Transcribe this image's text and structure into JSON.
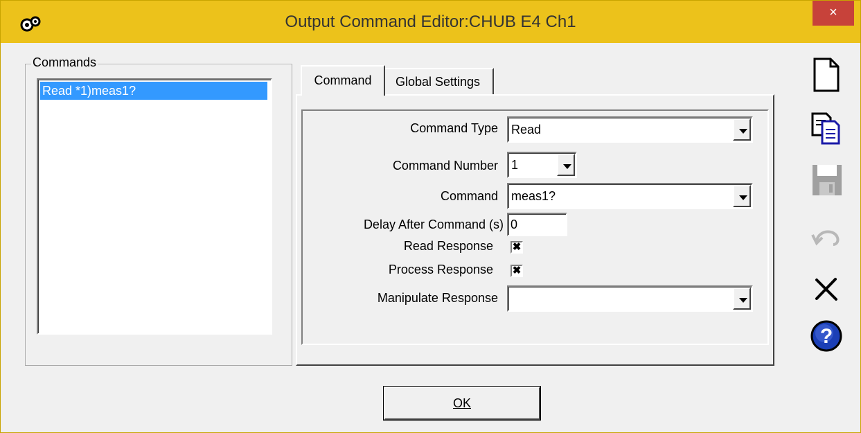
{
  "window": {
    "title": "Output Command Editor:CHUB E4 Ch1",
    "close_label": "×"
  },
  "commands_group": {
    "legend": "Commands",
    "items": [
      "Read *1)meas1?"
    ]
  },
  "tabs": [
    {
      "label": "Command"
    },
    {
      "label": "Global Settings"
    }
  ],
  "form": {
    "command_type": {
      "label": "Command Type",
      "value": "Read"
    },
    "command_number": {
      "label": "Command Number",
      "value": "1"
    },
    "command": {
      "label": "Command",
      "value": "meas1?"
    },
    "delay": {
      "label": "Delay After Command (s)",
      "value": "0"
    },
    "read_response": {
      "label": "Read Response",
      "checked": true,
      "mark": "✖"
    },
    "process_response": {
      "label": "Process Response",
      "checked": true,
      "mark": "✖"
    },
    "manipulate_response": {
      "label": "Manipulate Response",
      "value": ""
    }
  },
  "toolbar": [
    {
      "icon": "new-document-icon"
    },
    {
      "icon": "copy-icon"
    },
    {
      "icon": "save-icon",
      "disabled": true
    },
    {
      "icon": "undo-icon",
      "disabled": true
    },
    {
      "icon": "delete-icon"
    },
    {
      "icon": "help-icon"
    }
  ],
  "ok_button": {
    "label": "OK"
  },
  "colors": {
    "titlebar": "#ecc21b",
    "close": "#c7423a",
    "selection": "#3399ff"
  }
}
